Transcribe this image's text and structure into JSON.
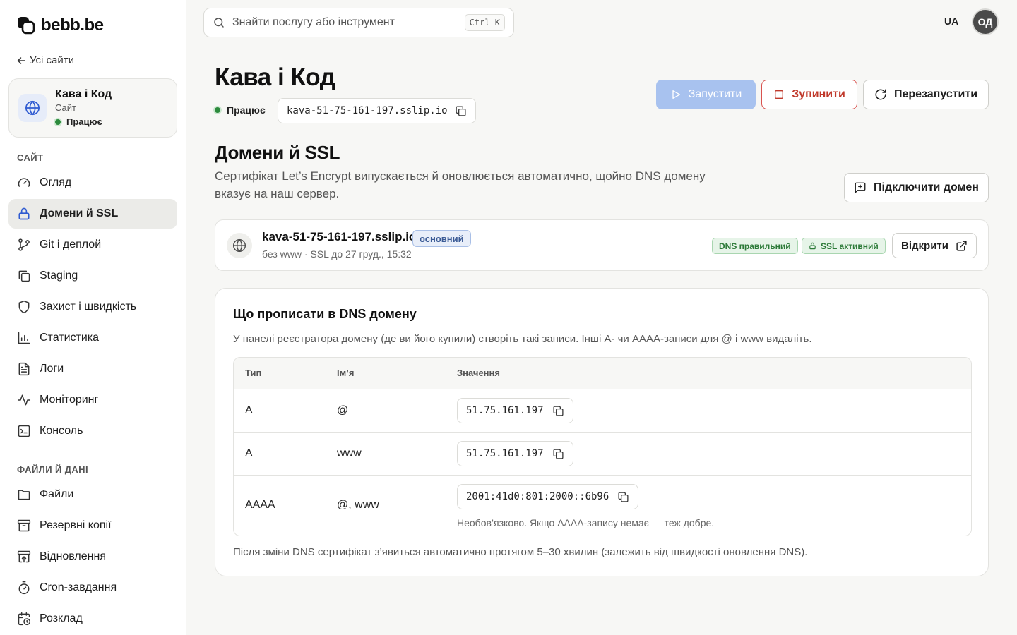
{
  "brand": {
    "name": "bebb.be"
  },
  "sidebar": {
    "back_label": "Усі сайти",
    "site": {
      "name": "Кава і Код",
      "type": "Сайт",
      "status": "Працює"
    },
    "section_site": "САЙТ",
    "items": [
      {
        "label": "Огляд",
        "icon": "gauge-icon"
      },
      {
        "label": "Домени й SSL",
        "icon": "lock-icon"
      },
      {
        "label": "Git і деплой",
        "icon": "git-branch-icon"
      },
      {
        "label": "Staging",
        "icon": "copy-stack-icon"
      },
      {
        "label": "Захист і швидкість",
        "icon": "shield-icon"
      },
      {
        "label": "Статистика",
        "icon": "bar-chart-icon"
      },
      {
        "label": "Логи",
        "icon": "document-icon"
      },
      {
        "label": "Моніторинг",
        "icon": "activity-icon"
      },
      {
        "label": "Консоль",
        "icon": "terminal-icon"
      }
    ],
    "section_files": "ФАЙЛИ Й ДАНІ",
    "items2": [
      {
        "label": "Файли",
        "icon": "folder-icon"
      },
      {
        "label": "Резервні копії",
        "icon": "archive-icon"
      },
      {
        "label": "Відновлення",
        "icon": "archive-restore-icon"
      },
      {
        "label": "Cron-завдання",
        "icon": "timer-icon"
      },
      {
        "label": "Розклад",
        "icon": "calendar-clock-icon"
      }
    ],
    "active_index": 1
  },
  "topbar": {
    "search_placeholder": "Знайти послугу або інструмент",
    "shortcut": "Ctrl K",
    "lang": "UA",
    "avatar_initials": "ОД"
  },
  "header": {
    "title": "Кава і Код",
    "status": "Працює",
    "host": "kava-51-75-161-197.sslip.io",
    "start_label": "Запустити",
    "stop_label": "Зупинити",
    "restart_label": "Перезапустити"
  },
  "domains": {
    "title": "Домени й SSL",
    "description": "Сертифікат Let’s Encrypt випускається й оновлюється автоматично, щойно DNS домену вказує на наш сервер.",
    "connect_label": "Підключити домен",
    "card": {
      "domain": "kava-51-75-161-197.sslip.io",
      "primary_badge": "основний",
      "meta": "без www · SSL до 27 груд., 15:32",
      "dns_badge": "DNS правильний",
      "ssl_badge": "SSL активний",
      "open_label": "Відкрити"
    }
  },
  "dns": {
    "title": "Що прописати в DNS домену",
    "description": "У панелі реєстратора домену (де ви його купили) створіть такі записи. Інші A- чи AAAA-записи для @ і www видаліть.",
    "columns": [
      "Тип",
      "Ім’я",
      "Значення"
    ],
    "rows": [
      {
        "type": "A",
        "name": "@",
        "value": "51.75.161.197",
        "note": ""
      },
      {
        "type": "A",
        "name": "www",
        "value": "51.75.161.197",
        "note": ""
      },
      {
        "type": "AAAA",
        "name": "@, www",
        "value": "2001:41d0:801:2000::6b96",
        "note": "Необов’язково. Якщо AAAA-запису немає — теж добре."
      }
    ],
    "footer": "Після зміни DNS сертифікат з’явиться автоматично протягом 5–30 хвилин (залежить від швидкості оновлення DNS)."
  },
  "colors": {
    "accent": "#a8c2ef",
    "danger": "#c0392b",
    "success": "#2c8a3d"
  }
}
